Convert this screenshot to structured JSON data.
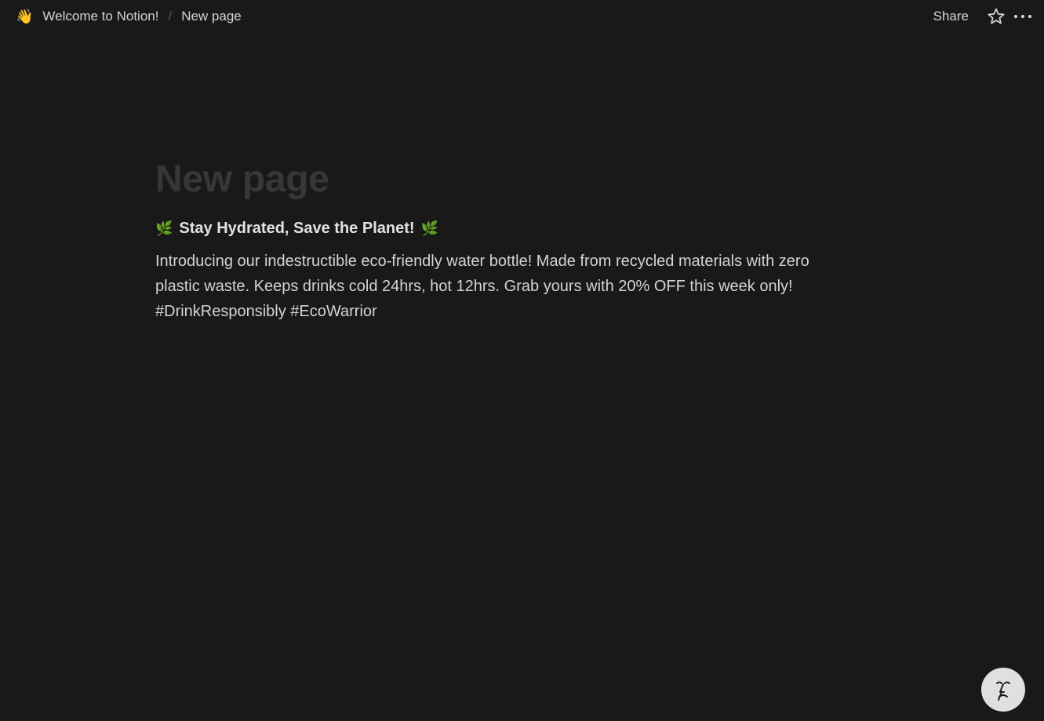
{
  "breadcrumb": {
    "workspace_emoji": "👋",
    "workspace_label": "Welcome to Notion!",
    "separator": "/",
    "page_label": "New page"
  },
  "topbar": {
    "share_label": "Share",
    "favorite_icon": "star-icon",
    "more_icon": "more-horizontal-icon"
  },
  "page": {
    "title": "New page",
    "heading": {
      "leading_emoji": "🌿",
      "text": "Stay Hydrated, Save the Planet!",
      "trailing_emoji": "🌿"
    },
    "body": {
      "line1": "Introducing our indestructible eco-friendly water bottle! Made from recycled materials with zero",
      "line2": "plastic waste. Keeps drinks cold 24hrs, hot 12hrs. Grab yours with 20% OFF this week only!",
      "line3": "#DrinkResponsibly #EcoWarrior"
    }
  },
  "help": {
    "icon": "notion-ai-face-icon"
  },
  "colors": {
    "background": "#191919",
    "title_placeholder": "#373737",
    "text": "#d4d4d4",
    "help_button_bg": "#e0e0e0"
  }
}
